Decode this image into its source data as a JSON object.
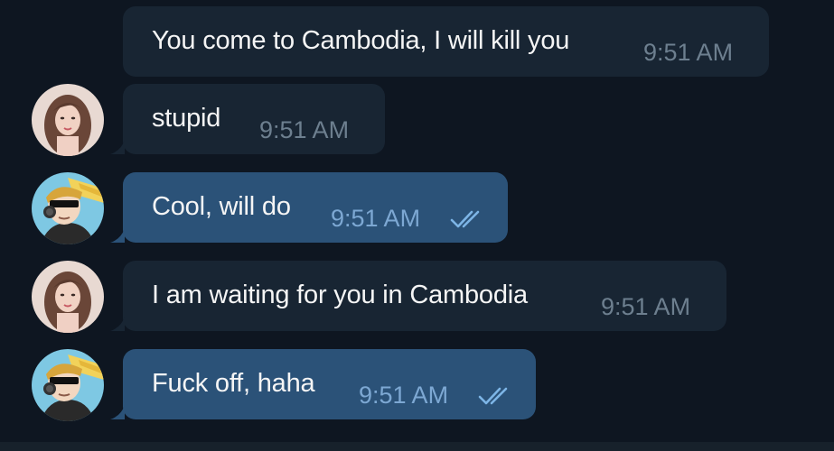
{
  "messages": [
    {
      "text": "You come to Cambodia, I will kill you",
      "time": "9:51 AM",
      "direction": "incoming",
      "avatar": "girl-avatar",
      "read": false
    },
    {
      "text": "stupid",
      "time": "9:51 AM",
      "direction": "incoming",
      "avatar": "girl-avatar",
      "read": false
    },
    {
      "text": "Cool, will do",
      "time": "9:51 AM",
      "direction": "outgoing",
      "avatar": "cartoon-avatar",
      "read": true
    },
    {
      "text": "I am waiting for you in Cambodia",
      "time": "9:51 AM",
      "direction": "incoming",
      "avatar": "girl-avatar",
      "read": false
    },
    {
      "text": "Fuck off, haha",
      "time": "9:51 AM",
      "direction": "outgoing",
      "avatar": "cartoon-avatar",
      "read": true
    }
  ],
  "colors": {
    "background": "#0e1621",
    "incoming_bubble": "#182533",
    "outgoing_bubble": "#2b5278",
    "incoming_time": "#6d7f8f",
    "outgoing_time": "#7da8d3",
    "read_ticks": "#7db5e6"
  }
}
